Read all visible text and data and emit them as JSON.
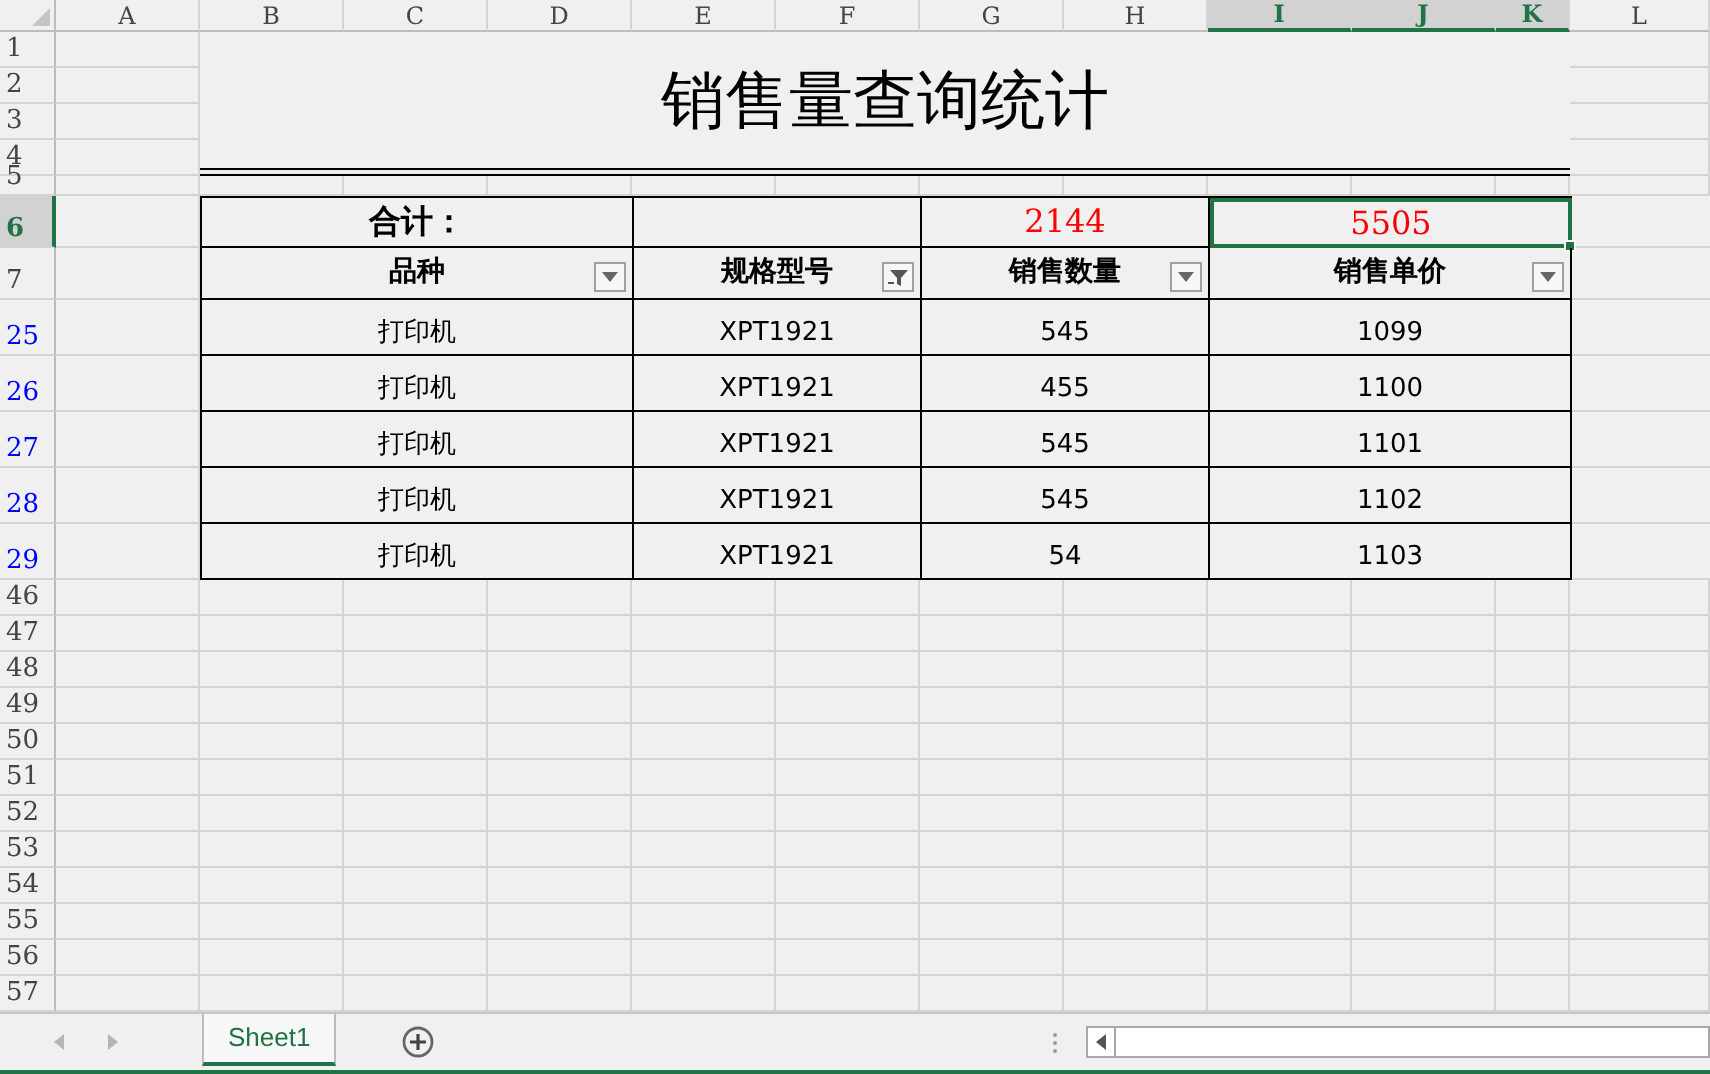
{
  "column_headers": [
    {
      "label": "A",
      "selected": false
    },
    {
      "label": "B",
      "selected": false
    },
    {
      "label": "C",
      "selected": false
    },
    {
      "label": "D",
      "selected": false
    },
    {
      "label": "E",
      "selected": false
    },
    {
      "label": "F",
      "selected": false
    },
    {
      "label": "G",
      "selected": false
    },
    {
      "label": "H",
      "selected": false
    },
    {
      "label": "I",
      "selected": true
    },
    {
      "label": "J",
      "selected": true
    },
    {
      "label": "K",
      "selected": true
    },
    {
      "label": "L",
      "selected": false
    }
  ],
  "title_rows": [
    "1",
    "2",
    "3",
    "4",
    "5"
  ],
  "title": "销售量查询统计",
  "summary": {
    "row": "6",
    "row_selected": true,
    "label": "合计：",
    "quantity_total": "2144",
    "price_total": "5505",
    "price_total_selected": true
  },
  "header": {
    "row": "7",
    "columns": [
      {
        "label": "品种",
        "filtered": false
      },
      {
        "label": "规格型号",
        "filtered": true
      },
      {
        "label": "销售数量",
        "filtered": false
      },
      {
        "label": "销售单价",
        "filtered": false
      }
    ]
  },
  "data_rows": [
    {
      "row": "25",
      "filtered": true,
      "cells": [
        "打印机",
        "XPT1921",
        "545",
        "1099"
      ]
    },
    {
      "row": "26",
      "filtered": true,
      "cells": [
        "打印机",
        "XPT1921",
        "455",
        "1100"
      ]
    },
    {
      "row": "27",
      "filtered": true,
      "cells": [
        "打印机",
        "XPT1921",
        "545",
        "1101"
      ]
    },
    {
      "row": "28",
      "filtered": true,
      "cells": [
        "打印机",
        "XPT1921",
        "545",
        "1102"
      ]
    },
    {
      "row": "29",
      "filtered": true,
      "cells": [
        "打印机",
        "XPT1921",
        "54",
        "1103"
      ]
    }
  ],
  "empty_rows": [
    "46",
    "47",
    "48",
    "49",
    "50",
    "51",
    "52",
    "53",
    "54",
    "55",
    "56",
    "57"
  ],
  "sheet_tabs": [
    {
      "label": "Sheet1",
      "selected": true
    }
  ]
}
